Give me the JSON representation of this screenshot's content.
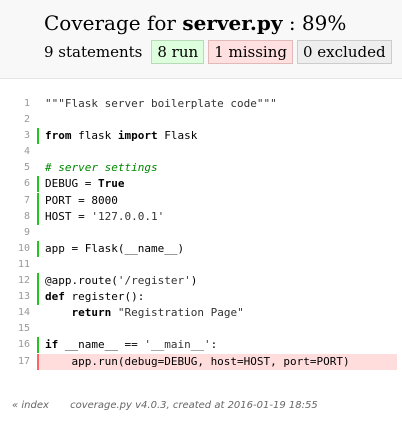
{
  "header": {
    "title_prefix": "Coverage for",
    "file_name": "server.py",
    "title_suffix": ": 89%",
    "statements": "9 statements",
    "run": "8 run",
    "missing": "1 missing",
    "excluded": "0 excluded"
  },
  "lines": [
    {
      "n": "1",
      "status": "none",
      "tokens": [
        {
          "t": "\"\"\"Flask server boilerplate code\"\"\"",
          "c": "str"
        }
      ]
    },
    {
      "n": "2",
      "status": "none",
      "tokens": []
    },
    {
      "n": "3",
      "status": "run",
      "tokens": [
        {
          "t": "from",
          "c": "kw"
        },
        {
          "t": " flask ",
          "c": ""
        },
        {
          "t": "import",
          "c": "kw"
        },
        {
          "t": " Flask",
          "c": ""
        }
      ]
    },
    {
      "n": "4",
      "status": "none",
      "tokens": []
    },
    {
      "n": "5",
      "status": "none",
      "tokens": [
        {
          "t": "# server settings",
          "c": "com"
        }
      ]
    },
    {
      "n": "6",
      "status": "run",
      "tokens": [
        {
          "t": "DEBUG = ",
          "c": ""
        },
        {
          "t": "True",
          "c": "kw"
        }
      ]
    },
    {
      "n": "7",
      "status": "run",
      "tokens": [
        {
          "t": "PORT = 8000",
          "c": ""
        }
      ]
    },
    {
      "n": "8",
      "status": "run",
      "tokens": [
        {
          "t": "HOST = ",
          "c": ""
        },
        {
          "t": "'127.0.0.1'",
          "c": "str"
        }
      ]
    },
    {
      "n": "9",
      "status": "none",
      "tokens": []
    },
    {
      "n": "10",
      "status": "run",
      "tokens": [
        {
          "t": "app = Flask(__name__)",
          "c": ""
        }
      ]
    },
    {
      "n": "11",
      "status": "none",
      "tokens": []
    },
    {
      "n": "12",
      "status": "run",
      "tokens": [
        {
          "t": "@app.route(",
          "c": ""
        },
        {
          "t": "'/register'",
          "c": "str"
        },
        {
          "t": ")",
          "c": ""
        }
      ]
    },
    {
      "n": "13",
      "status": "run",
      "tokens": [
        {
          "t": "def",
          "c": "kw"
        },
        {
          "t": " register():",
          "c": ""
        }
      ]
    },
    {
      "n": "14",
      "status": "none",
      "tokens": [
        {
          "t": "    ",
          "c": ""
        },
        {
          "t": "return",
          "c": "kw"
        },
        {
          "t": " ",
          "c": ""
        },
        {
          "t": "\"Registration Page\"",
          "c": "str"
        }
      ]
    },
    {
      "n": "15",
      "status": "none",
      "tokens": []
    },
    {
      "n": "16",
      "status": "run",
      "tokens": [
        {
          "t": "if",
          "c": "kw"
        },
        {
          "t": " __name__ == ",
          "c": ""
        },
        {
          "t": "'__main__'",
          "c": "str"
        },
        {
          "t": ":",
          "c": ""
        }
      ]
    },
    {
      "n": "17",
      "status": "mis",
      "tokens": [
        {
          "t": "    app.run(debug=DEBUG, host=HOST, port=PORT)",
          "c": ""
        }
      ]
    }
  ],
  "footer": {
    "index_link": "« index",
    "created": "coverage.py v4.0.3, created at 2016-01-19 18:55"
  },
  "colors": {
    "run_marker": "#1fc61f",
    "missing_marker": "#ff6464",
    "missing_background": "#ffdddd",
    "run_pill": "#ddffdd",
    "missing_pill": "#ffe0e0",
    "excluded_pill": "#eeeeee"
  }
}
